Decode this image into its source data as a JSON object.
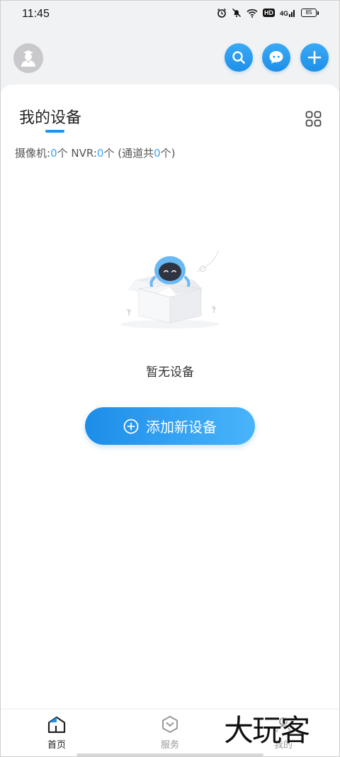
{
  "status_bar": {
    "time": "11:45",
    "hd": "HD",
    "network": "4G",
    "battery": "85"
  },
  "header": {
    "avatar_icon": "user-avatar-icon",
    "search_icon": "search-icon",
    "chat_icon": "chat-icon",
    "add_icon": "plus-icon",
    "accent_color": "#1f93ea"
  },
  "devices": {
    "title": "我的设备",
    "view_toggle_icon": "grid-icon",
    "count": {
      "camera_label": "摄像机:",
      "camera_count": "0",
      "unit": "个",
      "nvr_label": " NVR:",
      "nvr_count": "0",
      "channel_prefix": " (通道共",
      "channel_count": "0",
      "channel_suffix": "个)"
    },
    "empty_text": "暂无设备",
    "add_button_label": "添加新设备"
  },
  "bottom_nav": {
    "items": [
      {
        "label": "首页",
        "icon": "home-icon",
        "active": true
      },
      {
        "label": "服务",
        "icon": "service-icon",
        "active": false
      },
      {
        "label": "我的",
        "icon": "profile-icon",
        "active": false
      }
    ]
  },
  "watermark": "大玩客"
}
